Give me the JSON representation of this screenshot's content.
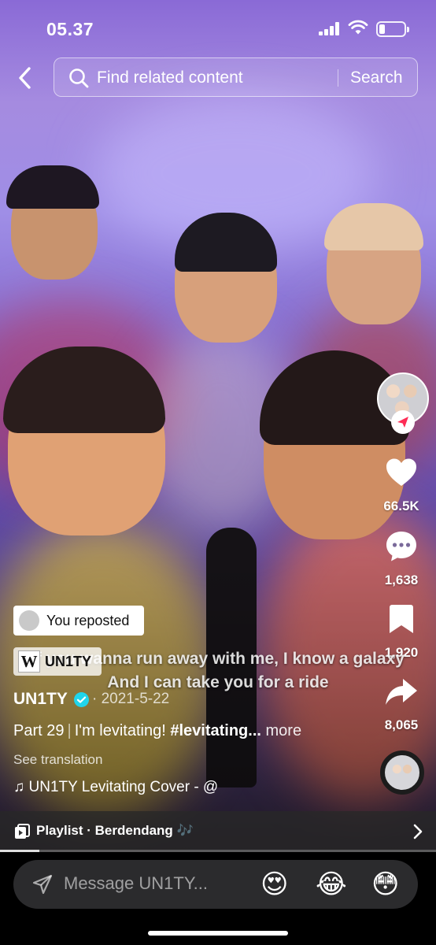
{
  "status_bar": {
    "time": "05.37"
  },
  "search": {
    "placeholder": "Find related content",
    "button_label": "Search"
  },
  "rail": {
    "like_count": "66.5K",
    "comment_count": "1,638",
    "save_count": "1,920",
    "share_count": "8,065"
  },
  "repost": {
    "label": "You reposted"
  },
  "wiki_tag": {
    "label": "UN1TY"
  },
  "lyrics": {
    "line1": "If you wanna run away with me, I know a galaxy",
    "line2": "And I can take you for a ride"
  },
  "post": {
    "author": "UN1TY",
    "date": "· 2021-5-22",
    "caption_part": "Part 29",
    "caption_text": "I'm levitating!",
    "caption_tag": "#levitating...",
    "caption_more": "more",
    "see_translation": "See translation",
    "music": "UN1TY Levitating Cover - @"
  },
  "playlist": {
    "label": "Playlist · Berdendang 🎶",
    "progress": 0.09
  },
  "message_bar": {
    "placeholder": "Message UN1TY...",
    "emojis": [
      "😍",
      "😂",
      "😳"
    ]
  }
}
